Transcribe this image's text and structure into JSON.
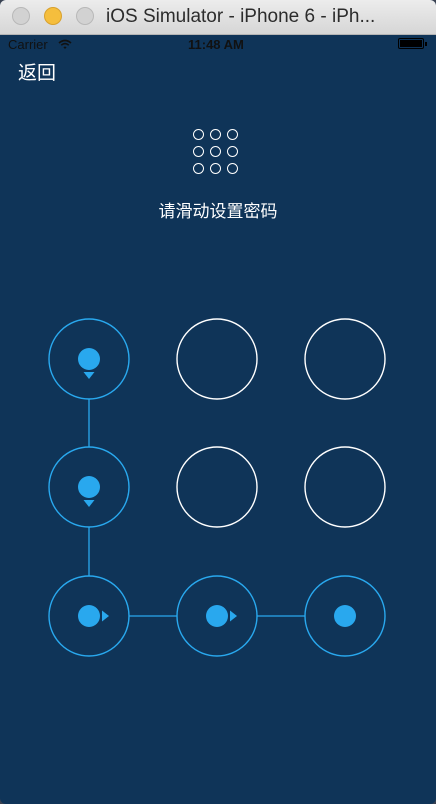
{
  "window": {
    "title": "iOS Simulator - iPhone 6 - iPh..."
  },
  "status_bar": {
    "carrier": "Carrier",
    "time": "11:48 AM"
  },
  "nav": {
    "back_label": "返回"
  },
  "lock": {
    "hint": "请滑动设置密码",
    "pattern_sequence": [
      1,
      4,
      7,
      8,
      9
    ],
    "colors": {
      "background": "#0f3458",
      "selected": "#29a8ee",
      "unselected": "#ffffff"
    },
    "icons": {
      "preview_grid": "nine-dot-grid-icon",
      "back": "text-back"
    }
  }
}
